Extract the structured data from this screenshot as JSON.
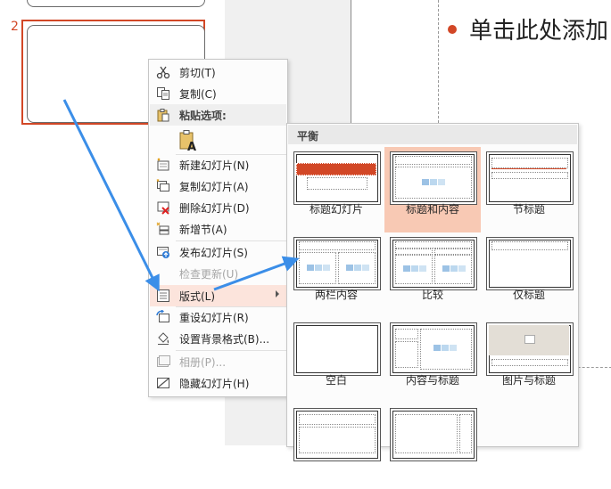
{
  "thumbnails": {
    "slide_number": "2"
  },
  "slide": {
    "placeholder_text": "单击此处添加"
  },
  "context_menu": {
    "items": [
      {
        "label": "剪切(T)",
        "icon": "scissors-icon",
        "enabled": true
      },
      {
        "label": "复制(C)",
        "icon": "copy-icon",
        "enabled": true
      },
      {
        "label": "粘贴选项:",
        "icon": "paste-icon",
        "enabled": true
      },
      {
        "label": "",
        "icon": "paste-text-only-icon",
        "enabled": true
      },
      {
        "label": "新建幻灯片(N)",
        "icon": "new-slide-icon",
        "enabled": true
      },
      {
        "label": "复制幻灯片(A)",
        "icon": "duplicate-slide-icon",
        "enabled": true
      },
      {
        "label": "删除幻灯片(D)",
        "icon": "delete-slide-icon",
        "enabled": true
      },
      {
        "label": "新增节(A)",
        "icon": "add-section-icon",
        "enabled": true
      },
      {
        "label": "发布幻灯片(S)",
        "icon": "publish-slide-icon",
        "enabled": true
      },
      {
        "label": "检查更新(U)",
        "icon": "check-updates-icon",
        "enabled": false
      },
      {
        "label": "版式(L)",
        "icon": "layout-icon",
        "enabled": true,
        "highlighted": true
      },
      {
        "label": "重设幻灯片(R)",
        "icon": "reset-slide-icon",
        "enabled": true
      },
      {
        "label": "设置背景格式(B)...",
        "icon": "format-background-icon",
        "enabled": true
      },
      {
        "label": "相册(P)...",
        "icon": "photo-album-icon",
        "enabled": false
      },
      {
        "label": "隐藏幻灯片(H)",
        "icon": "hide-slide-icon",
        "enabled": true
      }
    ]
  },
  "layout_gallery": {
    "title": "平衡",
    "selected": "标题和内容",
    "layouts": [
      {
        "label": "标题幻灯片"
      },
      {
        "label": "标题和内容"
      },
      {
        "label": "节标题"
      },
      {
        "label": "两栏内容"
      },
      {
        "label": "比较"
      },
      {
        "label": "仅标题"
      },
      {
        "label": "空白"
      },
      {
        "label": "内容与标题"
      },
      {
        "label": "图片与标题"
      },
      {
        "label": ""
      },
      {
        "label": ""
      }
    ]
  },
  "colors": {
    "accent": "#d24726",
    "highlight": "#fce4dc",
    "selected_layout": "#f8c9b4",
    "arrow": "#3b8ee8"
  }
}
